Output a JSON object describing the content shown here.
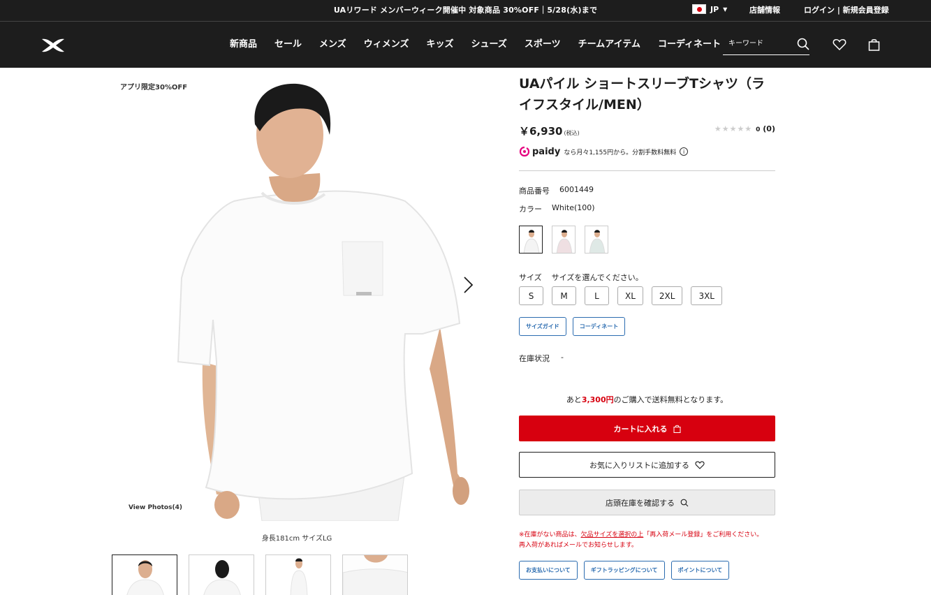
{
  "topbar": {
    "promo": "UAリワード メンバーウィーク開催中 対象商品 30%OFF｜5/28(水)まで",
    "locale": "JP",
    "store_info": "店舗情報",
    "login": "ログイン | 新規会員登録"
  },
  "header": {
    "nav": [
      "新商品",
      "セール",
      "メンズ",
      "ウィメンズ",
      "キッズ",
      "シューズ",
      "スポーツ",
      "チームアイテム",
      "コーディネート"
    ],
    "search_placeholder": "キーワード"
  },
  "gallery": {
    "badge": "アプリ限定30%OFF",
    "view_photos": "View Photos(4)",
    "caption": "身長181cm サイズLG"
  },
  "product": {
    "title": "UAパイル ショートスリーブTシャツ（ライフスタイル/MEN）",
    "price": "￥6,930",
    "tax": "(税込)",
    "stars": "★★★★★",
    "review_count": "0",
    "review_paren": "(0)",
    "paidy_brand": "paidy",
    "paidy_text": "なら月々1,155円から。分割手数料無料",
    "item_no_label": "商品番号",
    "item_no": "6001449",
    "color_label": "カラー",
    "color_value": "White(100)",
    "size_label": "サイズ",
    "size_hint": "サイズを選んでください。",
    "sizes": [
      "S",
      "M",
      "L",
      "XL",
      "2XL",
      "3XL"
    ],
    "size_guide": "サイズガイド",
    "coordinate": "コーディネート",
    "stock_label": "在庫状況",
    "stock_value": "-",
    "free_ship_pre": "あと",
    "free_ship_amount": "3,300円",
    "free_ship_post": "のご購入で送料無料となります。",
    "cart_button": "カートに入れる",
    "wishlist_button": "お気に入りリストに追加する",
    "store_stock_button": "店頭在庫を確認する",
    "notice_pre": "※在庫がない商品は、",
    "notice_link": "欠品サイズを選択の上",
    "notice_post": "「再入荷メール登録」をご利用ください。",
    "notice_line2": "再入荷があればメールでお知らせします。",
    "footer_buttons": [
      "お支払いについて",
      "ギフトラッピングについて",
      "ポイントについて"
    ]
  },
  "colors": {
    "accent": "#d7000f",
    "link": "#2b6cb0",
    "header_bg": "#1d1d1d"
  }
}
